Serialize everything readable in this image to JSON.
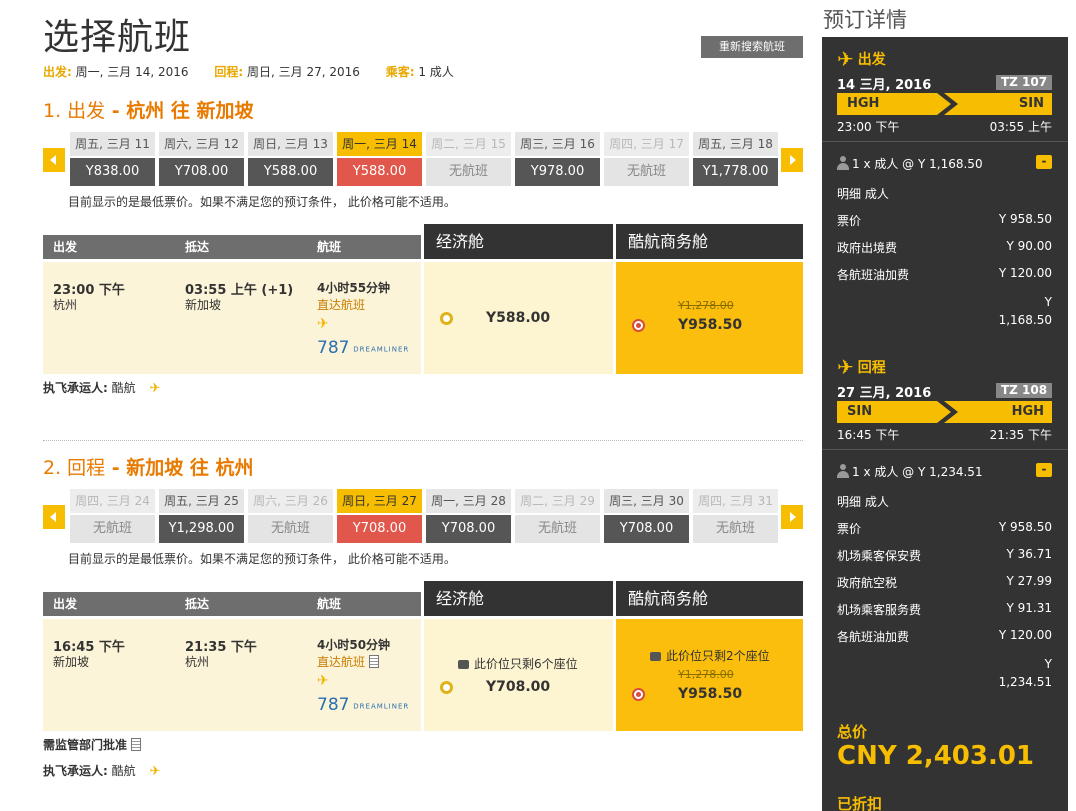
{
  "page": {
    "title": "选择航班",
    "research_label": "重新搜索航班",
    "summary": {
      "out_label": "出发:",
      "out_value": "周一, 三月 14, 2016",
      "ret_label": "回程:",
      "ret_value": "周日, 三月 27, 2016",
      "pax_label": "乘客:",
      "pax_value": "1 成人"
    }
  },
  "outbound": {
    "heading_num": "1. 出发",
    "heading_route": " - 杭州 往 新加坡",
    "dates": [
      {
        "day": "周五, 三月 11",
        "price": "Y838.00"
      },
      {
        "day": "周六, 三月 12",
        "price": "Y708.00"
      },
      {
        "day": "周日, 三月 13",
        "price": "Y588.00"
      },
      {
        "day": "周一, 三月 14",
        "price": "Y588.00"
      },
      {
        "day": "周二, 三月 15",
        "price": "无航班"
      },
      {
        "day": "周三, 三月 16",
        "price": "Y978.00"
      },
      {
        "day": "周四, 三月 17",
        "price": "无航班"
      },
      {
        "day": "周五, 三月 18",
        "price": "Y1,778.00"
      }
    ],
    "note": "目前显示的是最低票价。如果不满足您的预订条件， 此价格可能不适用。",
    "header": {
      "depart": "出发",
      "arrive": "抵达",
      "flight": "航班",
      "eco": "经济舱",
      "biz": "酷航商务舱"
    },
    "row": {
      "dep_time": "23:00 下午",
      "dep_city": "杭州",
      "arr_time": "03:55 上午 (+1)",
      "arr_city": "新加坡",
      "duration": "4小时55分钟",
      "direct": "直达航班",
      "aircraft_num": "787",
      "aircraft_name": "DREAMLINER",
      "eco_price": "Y588.00",
      "biz_old": "Y1,278.00",
      "biz_price": "Y958.50"
    },
    "carrier_label": "执飞承运人:",
    "carrier_value": "酷航"
  },
  "return": {
    "heading_num": "2. 回程",
    "heading_route": " - 新加坡 往 杭州",
    "dates": [
      {
        "day": "周四, 三月 24",
        "price": "无航班"
      },
      {
        "day": "周五, 三月 25",
        "price": "Y1,298.00"
      },
      {
        "day": "周六, 三月 26",
        "price": "无航班"
      },
      {
        "day": "周日, 三月 27",
        "price": "Y708.00"
      },
      {
        "day": "周一, 三月 28",
        "price": "Y708.00"
      },
      {
        "day": "周二, 三月 29",
        "price": "无航班"
      },
      {
        "day": "周三, 三月 30",
        "price": "Y708.00"
      },
      {
        "day": "周四, 三月 31",
        "price": "无航班"
      }
    ],
    "note": "目前显示的是最低票价。如果不满足您的预订条件， 此价格可能不适用。",
    "header": {
      "depart": "出发",
      "arrive": "抵达",
      "flight": "航班",
      "eco": "经济舱",
      "biz": "酷航商务舱"
    },
    "row": {
      "dep_time": "16:45 下午",
      "dep_city": "新加坡",
      "arr_time": "21:35 下午",
      "arr_city": "杭州",
      "duration": "4小时50分钟",
      "direct": "直达航班",
      "aircraft_num": "787",
      "aircraft_name": "DREAMLINER",
      "eco_seats": "此价位只剩6个座位",
      "eco_price": "Y708.00",
      "biz_seats": "此价位只剩2个座位",
      "biz_old": "Y1,278.00",
      "biz_price": "Y958.50"
    },
    "reg_note": "需监管部门批准",
    "carrier_label": "执飞承运人:",
    "carrier_value": "酷航"
  },
  "sidebar": {
    "title": "预订详情",
    "out": {
      "label": "出发",
      "date": "14 三月, 2016",
      "flight_no": "TZ 107",
      "from": "HGH",
      "to": "SIN",
      "dep": "23:00 下午",
      "arr": "03:55 上午",
      "pax": "1 x 成人 @ Y 1,168.50",
      "toggle": "-",
      "breakdown_title": "明细 成人",
      "items": [
        {
          "k": "票价",
          "v": "Y 958.50"
        },
        {
          "k": "政府出境费",
          "v": "Y 90.00"
        },
        {
          "k": "各航班油加费",
          "v": "Y 120.00"
        }
      ],
      "total_cur": "Y",
      "total_amt": "1,168.50"
    },
    "ret": {
      "label": "回程",
      "date": "27 三月, 2016",
      "flight_no": "TZ 108",
      "from": "SIN",
      "to": "HGH",
      "dep": "16:45 下午",
      "arr": "21:35 下午",
      "pax": "1 x 成人 @ Y 1,234.51",
      "toggle": "-",
      "breakdown_title": "明细 成人",
      "items": [
        {
          "k": "票价",
          "v": "Y 958.50"
        },
        {
          "k": "机场乘客保安费",
          "v": "Y 36.71"
        },
        {
          "k": "政府航空税",
          "v": "Y 27.99"
        },
        {
          "k": "机场乘客服务费",
          "v": "Y 91.31"
        },
        {
          "k": "各航班油加费",
          "v": "Y 120.00"
        }
      ],
      "total_cur": "Y",
      "total_amt": "1,234.51"
    },
    "total_label": "总价",
    "total_value": "CNY 2,403.01",
    "discount_label": "已折扣"
  },
  "colors": {
    "accent": "#f7bd00",
    "orange": "#e87a00",
    "selected": "#e2574b",
    "panel": "#333333"
  },
  "icons": {
    "plane": "plane-icon",
    "seat": "seat-icon",
    "doc": "document-icon",
    "person": "person-icon"
  }
}
